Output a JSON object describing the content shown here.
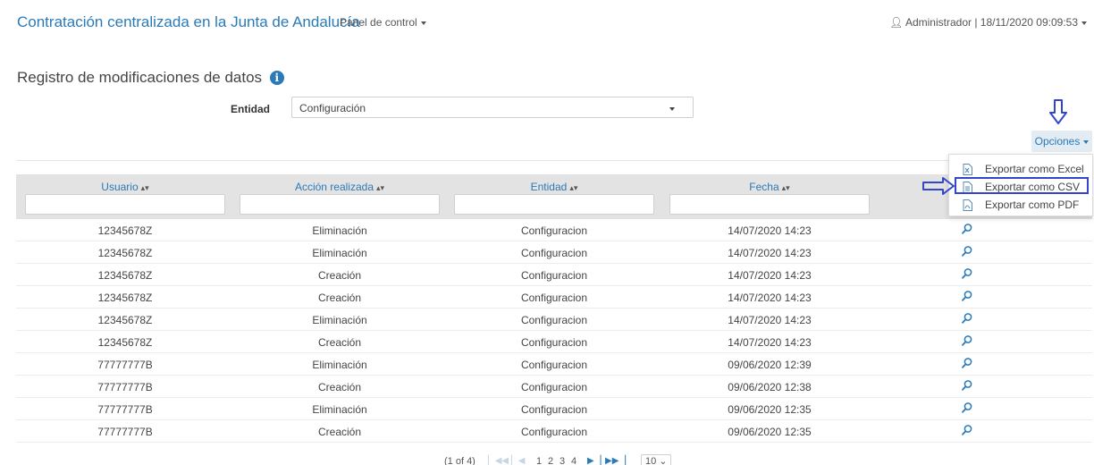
{
  "header": {
    "brand": "Contratación centralizada en la Junta de Andalucía",
    "panel_menu": "Panel de control",
    "user_info": "Administrador | 18/11/2020 09:09:53"
  },
  "page": {
    "title": "Registro de modificaciones de datos"
  },
  "filter": {
    "entidad_label": "Entidad",
    "entidad_value": "Configuración"
  },
  "options": {
    "button_label": "Opciones",
    "menu": [
      {
        "label": "Exportar como Excel",
        "icon": "excel-file-icon"
      },
      {
        "label": "Exportar como CSV",
        "icon": "csv-file-icon"
      },
      {
        "label": "Exportar como PDF",
        "icon": "pdf-file-icon"
      }
    ]
  },
  "table": {
    "columns": [
      "Usuario",
      "Acción realizada",
      "Entidad",
      "Fecha"
    ],
    "rows": [
      [
        "12345678Z",
        "Eliminación",
        "Configuracion",
        "14/07/2020 14:23"
      ],
      [
        "12345678Z",
        "Eliminación",
        "Configuracion",
        "14/07/2020 14:23"
      ],
      [
        "12345678Z",
        "Creación",
        "Configuracion",
        "14/07/2020 14:23"
      ],
      [
        "12345678Z",
        "Creación",
        "Configuracion",
        "14/07/2020 14:23"
      ],
      [
        "12345678Z",
        "Eliminación",
        "Configuracion",
        "14/07/2020 14:23"
      ],
      [
        "12345678Z",
        "Creación",
        "Configuracion",
        "14/07/2020 14:23"
      ],
      [
        "77777777B",
        "Eliminación",
        "Configuracion",
        "09/06/2020 12:39"
      ],
      [
        "77777777B",
        "Creación",
        "Configuracion",
        "09/06/2020 12:38"
      ],
      [
        "77777777B",
        "Eliminación",
        "Configuracion",
        "09/06/2020 12:35"
      ],
      [
        "77777777B",
        "Creación",
        "Configuracion",
        "09/06/2020 12:35"
      ]
    ]
  },
  "pager": {
    "status": "(1 of 4)",
    "pages": [
      "1",
      "2",
      "3",
      "4"
    ],
    "page_size": "10"
  },
  "colors": {
    "accent": "#2a7ab8",
    "annotation": "#3346c9",
    "header_bg": "#e3e3e3"
  }
}
